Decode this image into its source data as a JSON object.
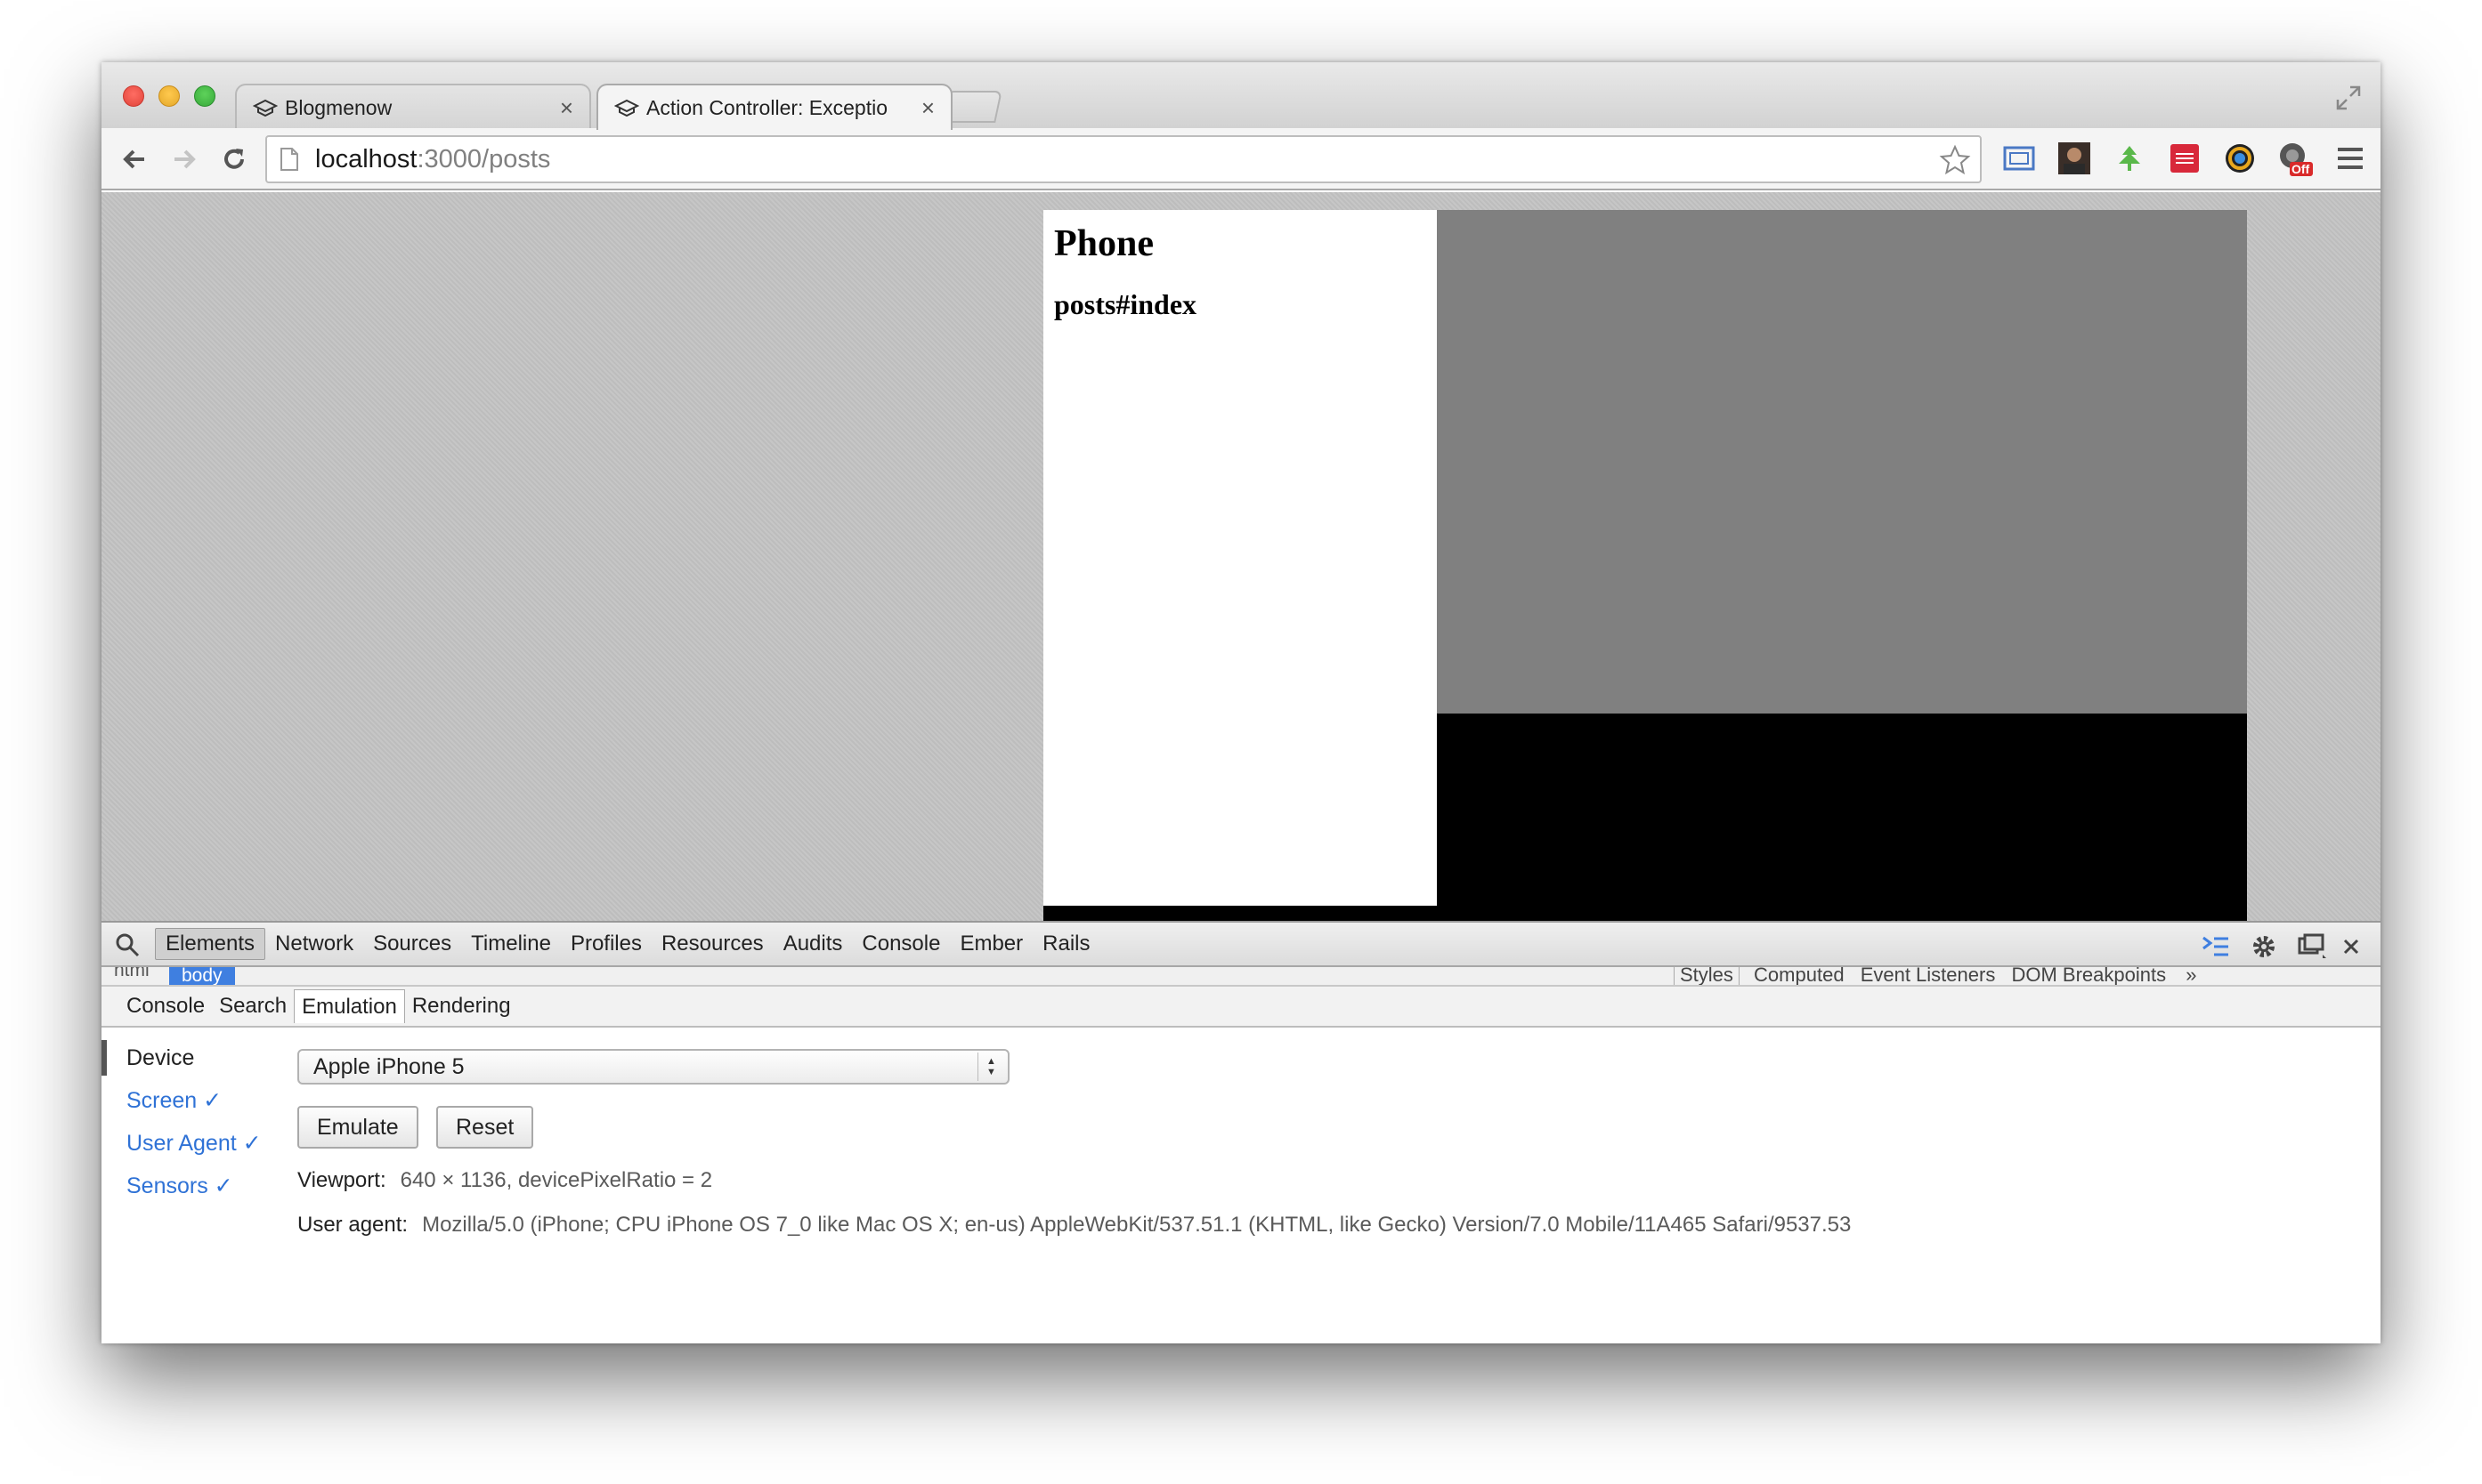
{
  "tabs": [
    {
      "title": "Blogmenow",
      "active": false
    },
    {
      "title": "Action Controller: Exceptio",
      "active": true
    }
  ],
  "address": {
    "host": "localhost",
    "rest": ":3000/posts"
  },
  "extensions": [
    "bookmark-star-icon",
    "cast-icon",
    "avatar-extension-icon",
    "leaf-extension-icon",
    "grid-extension-icon",
    "color-wheel-extension-icon",
    "off-badge-extension-icon",
    "menu-icon"
  ],
  "extension_badge": "Off",
  "page": {
    "heading": "Phone",
    "subheading": "posts#index"
  },
  "devtools": {
    "tabs": [
      "Elements",
      "Network",
      "Sources",
      "Timeline",
      "Profiles",
      "Resources",
      "Audits",
      "Console",
      "Ember",
      "Rails"
    ],
    "selected_tab": "Elements",
    "breadcrumbs": {
      "html": "html",
      "body": "body"
    },
    "side_tabs": {
      "styles": "Styles",
      "computed": "Computed",
      "listeners": "Event Listeners",
      "dom_bp": "DOM Breakpoints",
      "more": "»"
    },
    "drawer_tabs": [
      "Console",
      "Search",
      "Emulation",
      "Rendering"
    ],
    "selected_drawer_tab": "Emulation",
    "emulation": {
      "sidebar": [
        "Device",
        "Screen ✓",
        "User Agent ✓",
        "Sensors ✓"
      ],
      "device": "Apple iPhone 5",
      "emulate_label": "Emulate",
      "reset_label": "Reset",
      "viewport_label": "Viewport:",
      "viewport_value": "640 × 1136, devicePixelRatio = 2",
      "ua_label": "User agent:",
      "ua_value": "Mozilla/5.0 (iPhone; CPU iPhone OS 7_0 like Mac OS X; en-us) AppleWebKit/537.51.1 (KHTML, like Gecko) Version/7.0 Mobile/11A465 Safari/9537.53"
    }
  },
  "colors": {
    "accent_blue": "#2f72d6",
    "crumb_blue": "#3f7fe0",
    "emulation_gray": "#808080"
  }
}
